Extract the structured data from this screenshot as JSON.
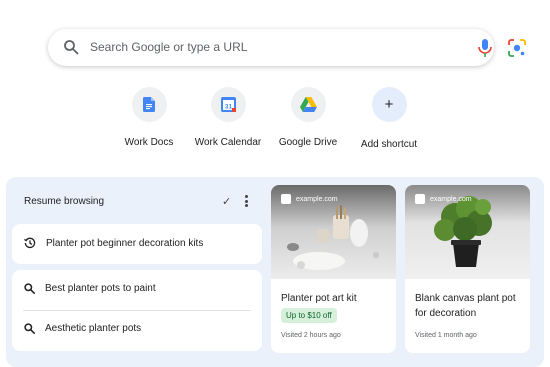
{
  "search": {
    "placeholder": "Search Google or type a URL"
  },
  "shortcuts": [
    {
      "label": "Work Docs",
      "icon": "docs-icon"
    },
    {
      "label": "Work Calendar",
      "icon": "calendar-icon",
      "icon_text": "31"
    },
    {
      "label": "Google Drive",
      "icon": "drive-icon"
    },
    {
      "label": "Add shortcut",
      "icon": "plus-icon",
      "icon_text": "+"
    }
  ],
  "resume": {
    "title": "Resume browsing",
    "check_glyph": "✓",
    "items": [
      {
        "label": "Planter pot beginner decoration kits",
        "icon": "history-icon"
      },
      {
        "label": "Best planter pots to paint",
        "icon": "search-icon"
      },
      {
        "label": "Aesthetic planter pots",
        "icon": "search-icon"
      }
    ]
  },
  "cards": [
    {
      "site": "example.com",
      "title": "Planter pot art kit",
      "badge": "Up to $10 off",
      "visited": "Visited 2 hours ago"
    },
    {
      "site": "example.com",
      "title": "Blank canvas plant pot for decoration",
      "visited": "Visited 1 month ago"
    }
  ],
  "colors": {
    "panel": "#eaf1fb",
    "badge_bg": "#d6f0dc",
    "badge_text": "#0d652d",
    "accent_blue": "#4285f4"
  }
}
